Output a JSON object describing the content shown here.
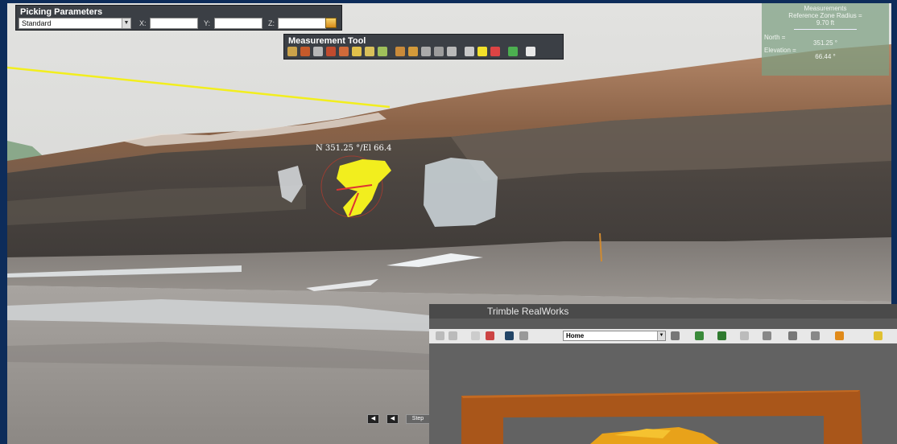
{
  "picking_parameters": {
    "title": "Picking Parameters",
    "mode": "Standard",
    "x_label": "X:",
    "y_label": "Y:",
    "z_label": "Z:",
    "x_value": "",
    "y_value": "",
    "z_value": ""
  },
  "measurement_tool": {
    "title": "Measurement Tool"
  },
  "measurements": {
    "title": "Measurements",
    "reference_zone_label": "Reference Zone Radius =",
    "reference_zone_value": "9.70 ft",
    "north_label": "North =",
    "north_value": "351.25 °",
    "elevation_label": "Elevation =",
    "elevation_value": "66.44 °"
  },
  "annotation": {
    "text": "N 351.25 °/El 66.4"
  },
  "nav": {
    "step_label": "Step"
  },
  "trimble_window": {
    "title": "Trimble RealWorks",
    "view_select": "Home"
  },
  "colors": {
    "panel_bg": "#3b3f45",
    "highlight_yellow": "#f2ee1e",
    "measure_panel": "#7da082",
    "frame_brown": "#a9561a"
  }
}
